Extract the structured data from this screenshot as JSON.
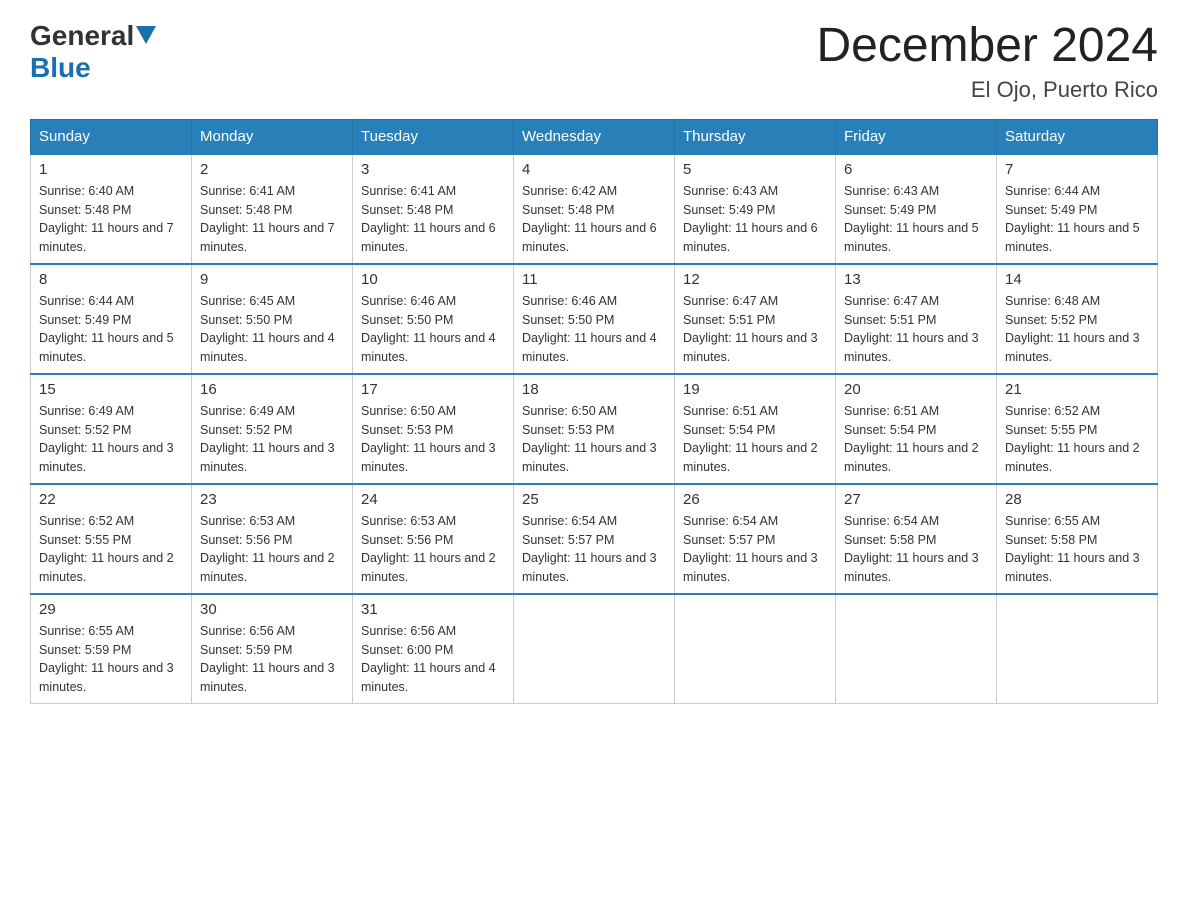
{
  "logo": {
    "general": "General",
    "blue": "Blue"
  },
  "title": {
    "month_year": "December 2024",
    "location": "El Ojo, Puerto Rico"
  },
  "days_of_week": [
    "Sunday",
    "Monday",
    "Tuesday",
    "Wednesday",
    "Thursday",
    "Friday",
    "Saturday"
  ],
  "weeks": [
    [
      {
        "day": "1",
        "sunrise": "6:40 AM",
        "sunset": "5:48 PM",
        "daylight": "11 hours and 7 minutes."
      },
      {
        "day": "2",
        "sunrise": "6:41 AM",
        "sunset": "5:48 PM",
        "daylight": "11 hours and 7 minutes."
      },
      {
        "day": "3",
        "sunrise": "6:41 AM",
        "sunset": "5:48 PM",
        "daylight": "11 hours and 6 minutes."
      },
      {
        "day": "4",
        "sunrise": "6:42 AM",
        "sunset": "5:48 PM",
        "daylight": "11 hours and 6 minutes."
      },
      {
        "day": "5",
        "sunrise": "6:43 AM",
        "sunset": "5:49 PM",
        "daylight": "11 hours and 6 minutes."
      },
      {
        "day": "6",
        "sunrise": "6:43 AM",
        "sunset": "5:49 PM",
        "daylight": "11 hours and 5 minutes."
      },
      {
        "day": "7",
        "sunrise": "6:44 AM",
        "sunset": "5:49 PM",
        "daylight": "11 hours and 5 minutes."
      }
    ],
    [
      {
        "day": "8",
        "sunrise": "6:44 AM",
        "sunset": "5:49 PM",
        "daylight": "11 hours and 5 minutes."
      },
      {
        "day": "9",
        "sunrise": "6:45 AM",
        "sunset": "5:50 PM",
        "daylight": "11 hours and 4 minutes."
      },
      {
        "day": "10",
        "sunrise": "6:46 AM",
        "sunset": "5:50 PM",
        "daylight": "11 hours and 4 minutes."
      },
      {
        "day": "11",
        "sunrise": "6:46 AM",
        "sunset": "5:50 PM",
        "daylight": "11 hours and 4 minutes."
      },
      {
        "day": "12",
        "sunrise": "6:47 AM",
        "sunset": "5:51 PM",
        "daylight": "11 hours and 3 minutes."
      },
      {
        "day": "13",
        "sunrise": "6:47 AM",
        "sunset": "5:51 PM",
        "daylight": "11 hours and 3 minutes."
      },
      {
        "day": "14",
        "sunrise": "6:48 AM",
        "sunset": "5:52 PM",
        "daylight": "11 hours and 3 minutes."
      }
    ],
    [
      {
        "day": "15",
        "sunrise": "6:49 AM",
        "sunset": "5:52 PM",
        "daylight": "11 hours and 3 minutes."
      },
      {
        "day": "16",
        "sunrise": "6:49 AM",
        "sunset": "5:52 PM",
        "daylight": "11 hours and 3 minutes."
      },
      {
        "day": "17",
        "sunrise": "6:50 AM",
        "sunset": "5:53 PM",
        "daylight": "11 hours and 3 minutes."
      },
      {
        "day": "18",
        "sunrise": "6:50 AM",
        "sunset": "5:53 PM",
        "daylight": "11 hours and 3 minutes."
      },
      {
        "day": "19",
        "sunrise": "6:51 AM",
        "sunset": "5:54 PM",
        "daylight": "11 hours and 2 minutes."
      },
      {
        "day": "20",
        "sunrise": "6:51 AM",
        "sunset": "5:54 PM",
        "daylight": "11 hours and 2 minutes."
      },
      {
        "day": "21",
        "sunrise": "6:52 AM",
        "sunset": "5:55 PM",
        "daylight": "11 hours and 2 minutes."
      }
    ],
    [
      {
        "day": "22",
        "sunrise": "6:52 AM",
        "sunset": "5:55 PM",
        "daylight": "11 hours and 2 minutes."
      },
      {
        "day": "23",
        "sunrise": "6:53 AM",
        "sunset": "5:56 PM",
        "daylight": "11 hours and 2 minutes."
      },
      {
        "day": "24",
        "sunrise": "6:53 AM",
        "sunset": "5:56 PM",
        "daylight": "11 hours and 2 minutes."
      },
      {
        "day": "25",
        "sunrise": "6:54 AM",
        "sunset": "5:57 PM",
        "daylight": "11 hours and 3 minutes."
      },
      {
        "day": "26",
        "sunrise": "6:54 AM",
        "sunset": "5:57 PM",
        "daylight": "11 hours and 3 minutes."
      },
      {
        "day": "27",
        "sunrise": "6:54 AM",
        "sunset": "5:58 PM",
        "daylight": "11 hours and 3 minutes."
      },
      {
        "day": "28",
        "sunrise": "6:55 AM",
        "sunset": "5:58 PM",
        "daylight": "11 hours and 3 minutes."
      }
    ],
    [
      {
        "day": "29",
        "sunrise": "6:55 AM",
        "sunset": "5:59 PM",
        "daylight": "11 hours and 3 minutes."
      },
      {
        "day": "30",
        "sunrise": "6:56 AM",
        "sunset": "5:59 PM",
        "daylight": "11 hours and 3 minutes."
      },
      {
        "day": "31",
        "sunrise": "6:56 AM",
        "sunset": "6:00 PM",
        "daylight": "11 hours and 4 minutes."
      },
      null,
      null,
      null,
      null
    ]
  ]
}
